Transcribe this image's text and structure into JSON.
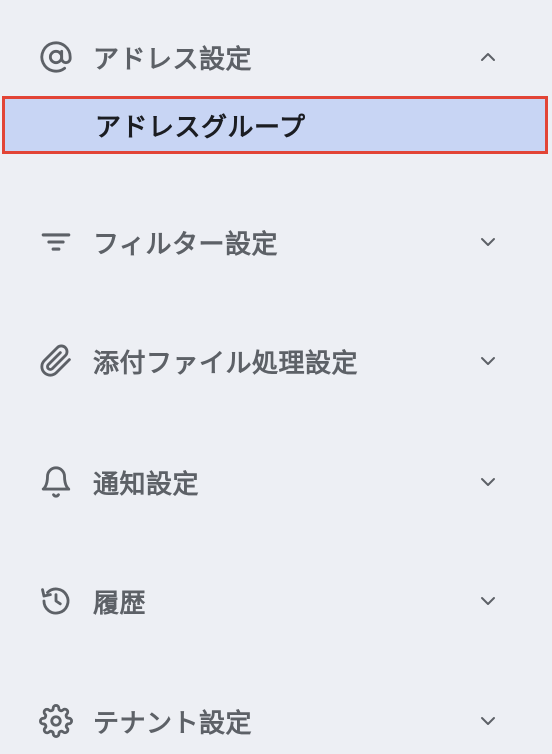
{
  "sidebar": {
    "sections": [
      {
        "label": "アドレス設定",
        "icon": "at-sign-icon",
        "expanded": true,
        "items": [
          {
            "label": "アドレスグループ",
            "selected": true
          }
        ]
      },
      {
        "label": "フィルター設定",
        "icon": "filter-icon",
        "expanded": false
      },
      {
        "label": "添付ファイル処理設定",
        "icon": "paperclip-icon",
        "expanded": false
      },
      {
        "label": "通知設定",
        "icon": "bell-icon",
        "expanded": false
      },
      {
        "label": "履歴",
        "icon": "history-icon",
        "expanded": false
      },
      {
        "label": "テナント設定",
        "icon": "gear-icon",
        "expanded": false
      }
    ]
  },
  "colors": {
    "background": "#edeff4",
    "text": "#5d6167",
    "selected_background": "#c8d5f4",
    "selected_text": "#1b1d22",
    "highlight_border": "#e24436"
  }
}
